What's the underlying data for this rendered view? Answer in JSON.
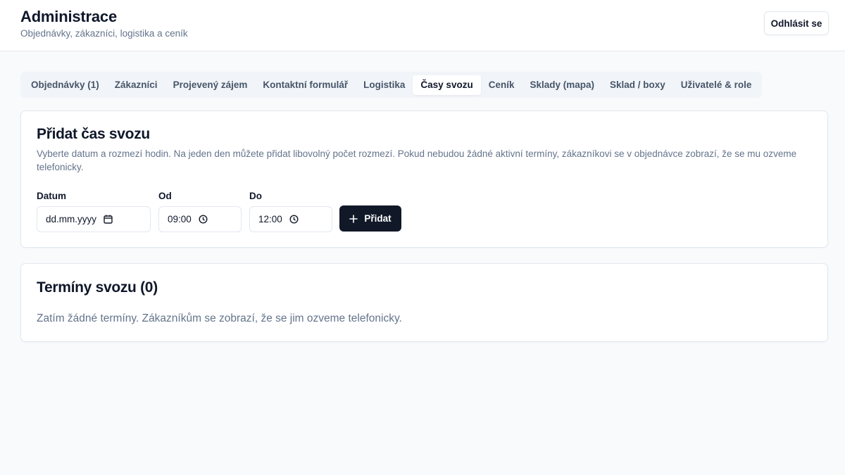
{
  "header": {
    "title": "Administrace",
    "subtitle": "Objednávky, zákazníci, logistika a ceník",
    "logout_label": "Odhlásit se"
  },
  "tabs": [
    {
      "label": "Objednávky (1)",
      "active": false
    },
    {
      "label": "Zákazníci",
      "active": false
    },
    {
      "label": "Projevený zájem",
      "active": false
    },
    {
      "label": "Kontaktní formulář",
      "active": false
    },
    {
      "label": "Logistika",
      "active": false
    },
    {
      "label": "Časy svozu",
      "active": true
    },
    {
      "label": "Ceník",
      "active": false
    },
    {
      "label": "Sklady (mapa)",
      "active": false
    },
    {
      "label": "Sklad / boxy",
      "active": false
    },
    {
      "label": "Uživatelé & role",
      "active": false
    }
  ],
  "add_card": {
    "title": "Přidat čas svozu",
    "description": "Vyberte datum a rozmezí hodin. Na jeden den můžete přidat libovolný počet rozmezí. Pokud nebudou žádné aktivní termíny, zákazníkovi se v objednávce zobrazí, že se mu ozveme telefonicky.",
    "date_label": "Datum",
    "date_value": "dd.mm.yyyy",
    "from_label": "Od",
    "from_value": "09:00",
    "to_label": "Do",
    "to_value": "12:00",
    "add_label": "Přidat",
    "icons": {
      "date": "calendar-icon",
      "time": "clock-icon",
      "add": "plus-icon"
    }
  },
  "list_card": {
    "title": "Termíny svozu (0)",
    "empty_text": "Zatím žádné termíny. Zákazníkům se zobrazí, že se jim ozveme telefonicky."
  },
  "colors": {
    "page_bg": "#f8fafc",
    "primary_button": "#111827",
    "muted_text": "#64748b"
  }
}
